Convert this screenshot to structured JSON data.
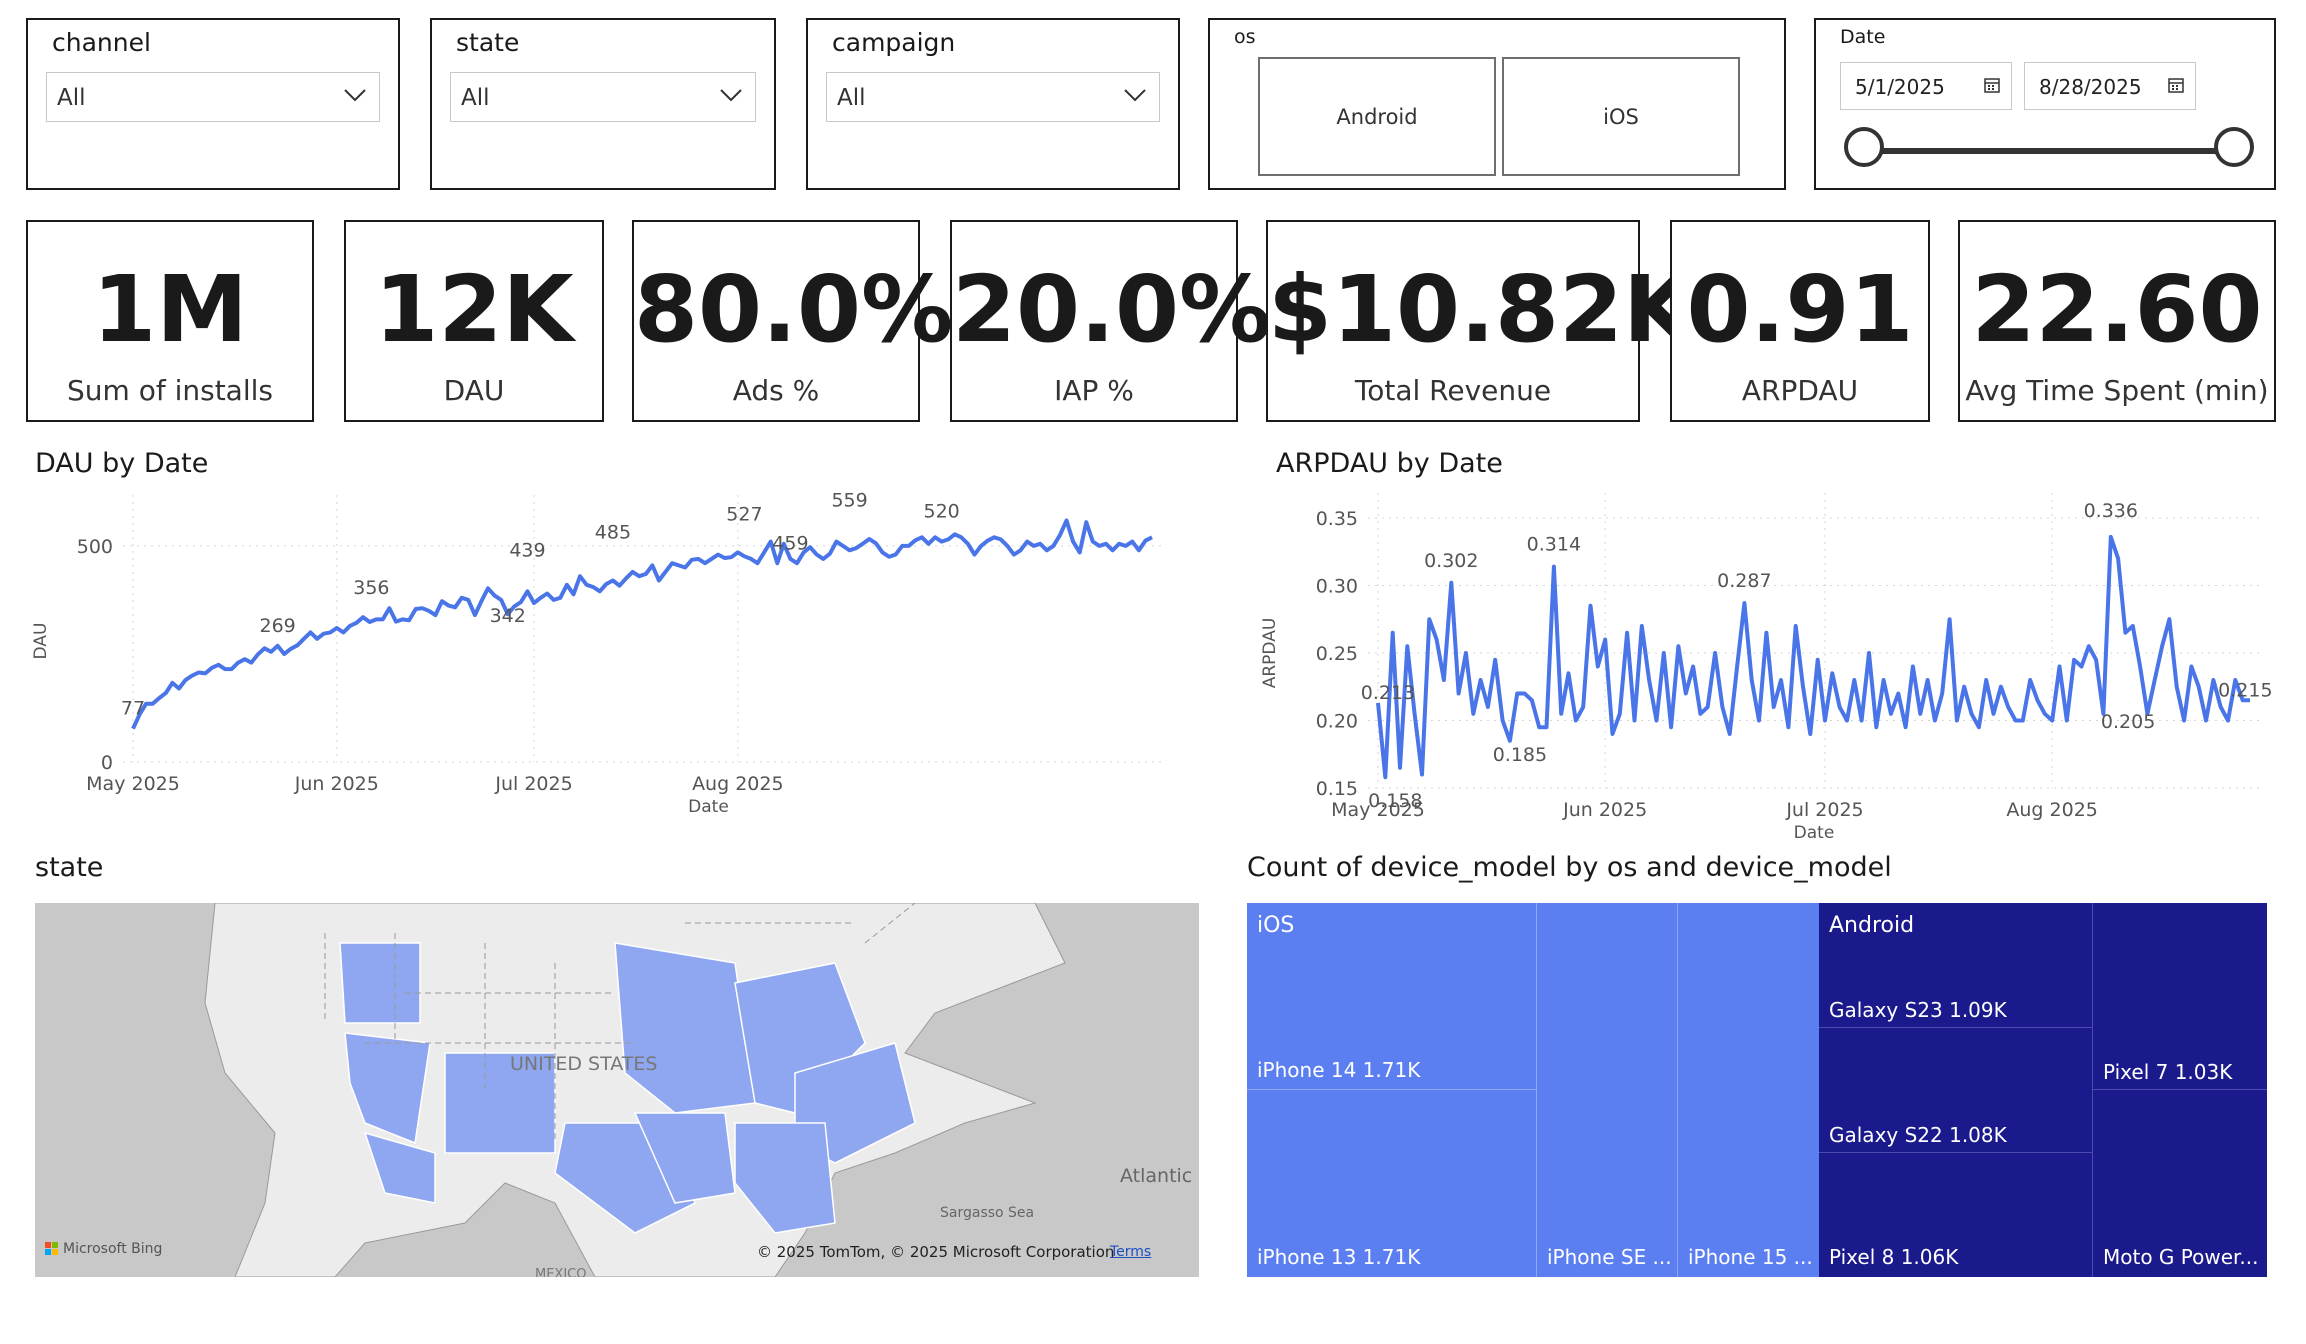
{
  "slicers": {
    "channel": {
      "title": "channel",
      "value": "All"
    },
    "state": {
      "title": "state",
      "value": "All"
    },
    "campaign": {
      "title": "campaign",
      "value": "All"
    },
    "os": {
      "title": "os",
      "options": [
        "Android",
        "iOS"
      ]
    },
    "date": {
      "title": "Date",
      "start": "5/1/2025",
      "end": "8/28/2025"
    }
  },
  "kpis": [
    {
      "value": "1M",
      "label": "Sum of installs"
    },
    {
      "value": "12K",
      "label": "DAU"
    },
    {
      "value": "80.0%",
      "label": "Ads %"
    },
    {
      "value": "20.0%",
      "label": "IAP %"
    },
    {
      "value": "$10.82K",
      "label": "Total Revenue"
    },
    {
      "value": "0.91",
      "label": "ARPDAU"
    },
    {
      "value": "22.60",
      "label": "Avg Time Spent (min)"
    }
  ],
  "dau_chart": {
    "title": "DAU by Date"
  },
  "arpdau_chart": {
    "title": "ARPDAU by Date"
  },
  "chart_data": [
    {
      "type": "line",
      "title": "DAU by Date",
      "xlabel": "Date",
      "ylabel": "DAU",
      "x_ticks": [
        "May 2025",
        "Jun 2025",
        "Jul 2025",
        "Aug 2025"
      ],
      "y_ticks": [
        "0",
        "500"
      ],
      "ylim": [
        0,
        560
      ],
      "color": "#4a75e8",
      "series": [
        {
          "values": [
            77,
            110,
            135,
            135,
            148,
            160,
            183,
            170,
            190,
            200,
            207,
            205,
            218,
            225,
            215,
            215,
            230,
            238,
            230,
            249,
            263,
            255,
            269,
            250,
            262,
            270,
            285,
            300,
            285,
            297,
            300,
            310,
            300,
            315,
            322,
            335,
            324,
            330,
            330,
            356,
            325,
            330,
            328,
            354,
            356,
            350,
            340,
            372,
            362,
            358,
            380,
            375,
            340,
            372,
            402,
            385,
            375,
            342,
            360,
            370,
            395,
            368,
            380,
            390,
            375,
            380,
            410,
            388,
            430,
            410,
            405,
            395,
            412,
            420,
            408,
            425,
            440,
            430,
            435,
            455,
            420,
            440,
            460,
            455,
            450,
            468,
            470,
            460,
            470,
            480,
            472,
            474,
            485,
            476,
            470,
            460,
            485,
            510,
            460,
            505,
            470,
            460,
            485,
            497,
            480,
            470,
            482,
            510,
            500,
            490,
            495,
            505,
            516,
            506,
            485,
            475,
            480,
            500,
            500,
            513,
            520,
            505,
            520,
            510,
            515,
            527,
            520,
            505,
            480,
            500,
            512,
            520,
            515,
            500,
            480,
            490,
            510,
            500,
            505,
            490,
            500,
            525,
            559,
            510,
            485,
            555,
            510,
            500,
            505,
            490,
            505,
            500,
            510,
            490,
            512,
            520
          ]
        }
      ],
      "data_labels": [
        {
          "x": "May 2025",
          "y": 77,
          "label": "77"
        },
        {
          "x": "May 2025",
          "y": 269,
          "label": "269"
        },
        {
          "x": "Jun 2025",
          "y": 356,
          "label": "356"
        },
        {
          "x": "Jun 2025",
          "y": 342,
          "label": "342"
        },
        {
          "x": "Jul 2025",
          "y": 439,
          "label": "439"
        },
        {
          "x": "Jul 2025",
          "y": 485,
          "label": "485"
        },
        {
          "x": "Aug 2025",
          "y": 527,
          "label": "527"
        },
        {
          "x": "Aug 2025",
          "y": 459,
          "label": "459"
        },
        {
          "x": "Aug 2025",
          "y": 559,
          "label": "559"
        },
        {
          "x": "Aug 2025",
          "y": 520,
          "label": "520"
        }
      ],
      "grid": true
    },
    {
      "type": "line",
      "title": "ARPDAU by Date",
      "xlabel": "Date",
      "ylabel": "ARPDAU",
      "x_ticks": [
        "May 2025",
        "Jun 2025",
        "Jul 2025",
        "Aug 2025"
      ],
      "y_ticks": [
        "0.15",
        "0.20",
        "0.25",
        "0.30",
        "0.35"
      ],
      "ylim": [
        0.15,
        0.35
      ],
      "color": "#4a75e8",
      "series": [
        {
          "values": [
            0.213,
            0.158,
            0.265,
            0.165,
            0.255,
            0.205,
            0.16,
            0.275,
            0.26,
            0.23,
            0.302,
            0.22,
            0.25,
            0.205,
            0.23,
            0.21,
            0.245,
            0.2,
            0.185,
            0.22,
            0.22,
            0.215,
            0.195,
            0.195,
            0.314,
            0.205,
            0.235,
            0.2,
            0.21,
            0.285,
            0.24,
            0.26,
            0.19,
            0.205,
            0.265,
            0.2,
            0.27,
            0.23,
            0.2,
            0.25,
            0.195,
            0.255,
            0.22,
            0.24,
            0.205,
            0.21,
            0.25,
            0.21,
            0.19,
            0.24,
            0.287,
            0.23,
            0.2,
            0.265,
            0.21,
            0.23,
            0.195,
            0.27,
            0.225,
            0.19,
            0.245,
            0.2,
            0.235,
            0.21,
            0.2,
            0.23,
            0.2,
            0.25,
            0.195,
            0.23,
            0.205,
            0.22,
            0.195,
            0.24,
            0.205,
            0.23,
            0.2,
            0.22,
            0.275,
            0.2,
            0.225,
            0.205,
            0.195,
            0.23,
            0.205,
            0.225,
            0.21,
            0.2,
            0.2,
            0.23,
            0.215,
            0.205,
            0.2,
            0.24,
            0.2,
            0.245,
            0.24,
            0.255,
            0.245,
            0.205,
            0.336,
            0.32,
            0.265,
            0.27,
            0.24,
            0.205,
            0.23,
            0.255,
            0.275,
            0.225,
            0.2,
            0.24,
            0.225,
            0.2,
            0.23,
            0.21,
            0.2,
            0.23,
            0.215,
            0.215
          ]
        }
      ],
      "data_labels": [
        {
          "x": "May 2025",
          "y": 0.213,
          "label": "0.213"
        },
        {
          "x": "May 2025",
          "y": 0.158,
          "label": "0.158"
        },
        {
          "x": "May 2025",
          "y": 0.302,
          "label": "0.302"
        },
        {
          "x": "Jun 2025",
          "y": 0.185,
          "label": "0.185"
        },
        {
          "x": "Jun 2025",
          "y": 0.314,
          "label": "0.314"
        },
        {
          "x": "Jul 2025",
          "y": 0.287,
          "label": "0.287"
        },
        {
          "x": "Aug 2025",
          "y": 0.336,
          "label": "0.336"
        },
        {
          "x": "Aug 2025",
          "y": 0.205,
          "label": "0.205"
        },
        {
          "x": "Aug 2025",
          "y": 0.215,
          "label": "0.215"
        }
      ],
      "grid": true
    },
    {
      "type": "treemap",
      "title": "Count of device_model by os and device_model",
      "groups": [
        {
          "name": "iOS",
          "color": "#5b7ff0",
          "items": [
            {
              "label": "iPhone 14 1.71K",
              "value": 1710
            },
            {
              "label": "iPhone 13 1.71K",
              "value": 1710
            },
            {
              "label": "iPhone SE ...",
              "value": null
            },
            {
              "label": "iPhone 15 ...",
              "value": null
            }
          ]
        },
        {
          "name": "Android",
          "color": "#1a1a8c",
          "items": [
            {
              "label": "Galaxy S23 1.09K",
              "value": 1090
            },
            {
              "label": "Galaxy S22 1.08K",
              "value": 1080
            },
            {
              "label": "Pixel 8 1.06K",
              "value": 1060
            },
            {
              "label": "Pixel 7 1.03K",
              "value": 1030
            },
            {
              "label": "Moto G Power...",
              "value": null
            }
          ]
        }
      ]
    }
  ],
  "map": {
    "title": "state",
    "country_label": "UNITED STATES",
    "ocean_label": "Atlantic",
    "sea_label": "Sargasso Sea",
    "mexico_label": "MEXICO",
    "attribution": "© 2025 TomTom, © 2025 Microsoft Corporation",
    "terms": "Terms",
    "provider": "Microsoft Bing",
    "highlight_color": "#8fa6f0"
  }
}
